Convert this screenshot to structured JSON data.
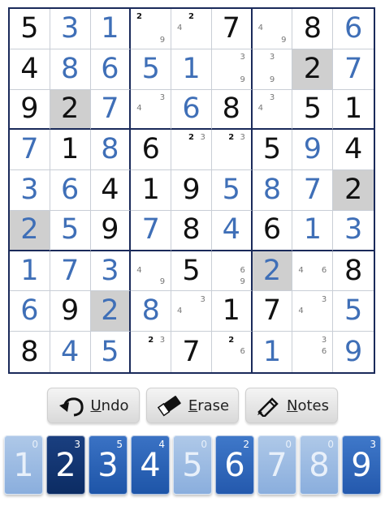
{
  "grid": [
    [
      {
        "v": "5",
        "t": "given"
      },
      {
        "v": "3",
        "t": "user"
      },
      {
        "v": "1",
        "t": "user"
      },
      {
        "v": "",
        "notes": [
          "2",
          "",
          "",
          "",
          "",
          "",
          "",
          "",
          "9"
        ],
        "bold": [
          "2"
        ]
      },
      {
        "v": "",
        "notes": [
          "",
          "2",
          "",
          "4",
          "",
          "",
          "",
          "",
          ""
        ],
        "bold": [
          "2"
        ]
      },
      {
        "v": "7",
        "t": "given"
      },
      {
        "v": "",
        "notes": [
          "",
          "",
          "",
          "4",
          "",
          "",
          "",
          "",
          "9"
        ]
      },
      {
        "v": "8",
        "t": "given"
      },
      {
        "v": "6",
        "t": "user"
      }
    ],
    [
      {
        "v": "4",
        "t": "given"
      },
      {
        "v": "8",
        "t": "user"
      },
      {
        "v": "6",
        "t": "user"
      },
      {
        "v": "5",
        "t": "user"
      },
      {
        "v": "1",
        "t": "user"
      },
      {
        "v": "",
        "notes": [
          "",
          "",
          "3",
          "",
          "",
          "",
          "",
          "",
          "9"
        ]
      },
      {
        "v": "",
        "notes": [
          "",
          "3",
          "",
          "",
          "",
          "",
          "",
          "9",
          ""
        ]
      },
      {
        "v": "2",
        "t": "given",
        "hl": true
      },
      {
        "v": "7",
        "t": "user"
      }
    ],
    [
      {
        "v": "9",
        "t": "given"
      },
      {
        "v": "2",
        "t": "given",
        "hl": true
      },
      {
        "v": "7",
        "t": "user"
      },
      {
        "v": "",
        "notes": [
          "",
          "",
          "3",
          "4",
          "",
          "",
          "",
          "",
          ""
        ]
      },
      {
        "v": "6",
        "t": "user"
      },
      {
        "v": "8",
        "t": "given"
      },
      {
        "v": "",
        "notes": [
          "",
          "3",
          "",
          "4",
          "",
          "",
          "",
          "",
          ""
        ]
      },
      {
        "v": "5",
        "t": "given"
      },
      {
        "v": "1",
        "t": "given"
      }
    ],
    [
      {
        "v": "7",
        "t": "user"
      },
      {
        "v": "1",
        "t": "given"
      },
      {
        "v": "8",
        "t": "user"
      },
      {
        "v": "6",
        "t": "given"
      },
      {
        "v": "",
        "notes": [
          "",
          "2",
          "3",
          "",
          "",
          "",
          "",
          "",
          ""
        ],
        "bold": [
          "2"
        ]
      },
      {
        "v": "",
        "notes": [
          "",
          "2",
          "3",
          "",
          "",
          "",
          "",
          "",
          ""
        ],
        "bold": [
          "2"
        ]
      },
      {
        "v": "5",
        "t": "given"
      },
      {
        "v": "9",
        "t": "user"
      },
      {
        "v": "4",
        "t": "given"
      }
    ],
    [
      {
        "v": "3",
        "t": "user"
      },
      {
        "v": "6",
        "t": "user"
      },
      {
        "v": "4",
        "t": "given"
      },
      {
        "v": "1",
        "t": "given"
      },
      {
        "v": "9",
        "t": "given"
      },
      {
        "v": "5",
        "t": "user"
      },
      {
        "v": "8",
        "t": "user"
      },
      {
        "v": "7",
        "t": "user"
      },
      {
        "v": "2",
        "t": "given",
        "hl": true
      }
    ],
    [
      {
        "v": "2",
        "t": "user",
        "hl": true
      },
      {
        "v": "5",
        "t": "user"
      },
      {
        "v": "9",
        "t": "given"
      },
      {
        "v": "7",
        "t": "user"
      },
      {
        "v": "8",
        "t": "given"
      },
      {
        "v": "4",
        "t": "user"
      },
      {
        "v": "6",
        "t": "given"
      },
      {
        "v": "1",
        "t": "user"
      },
      {
        "v": "3",
        "t": "user"
      }
    ],
    [
      {
        "v": "1",
        "t": "user"
      },
      {
        "v": "7",
        "t": "user"
      },
      {
        "v": "3",
        "t": "user"
      },
      {
        "v": "",
        "notes": [
          "",
          "",
          "",
          "4",
          "",
          "",
          "",
          "",
          "9"
        ]
      },
      {
        "v": "5",
        "t": "given"
      },
      {
        "v": "",
        "notes": [
          "",
          "",
          "",
          "",
          "",
          "6",
          "",
          "",
          "9"
        ]
      },
      {
        "v": "2",
        "t": "user",
        "hl": true
      },
      {
        "v": "",
        "notes": [
          "",
          "",
          "",
          "4",
          "",
          "6",
          "",
          "",
          ""
        ]
      },
      {
        "v": "8",
        "t": "given"
      }
    ],
    [
      {
        "v": "6",
        "t": "user"
      },
      {
        "v": "9",
        "t": "given"
      },
      {
        "v": "2",
        "t": "user",
        "hl": true
      },
      {
        "v": "8",
        "t": "user"
      },
      {
        "v": "",
        "notes": [
          "",
          "",
          "3",
          "4",
          "",
          "",
          "",
          "",
          ""
        ]
      },
      {
        "v": "1",
        "t": "given"
      },
      {
        "v": "7",
        "t": "given"
      },
      {
        "v": "",
        "notes": [
          "",
          "",
          "3",
          "4",
          "",
          "",
          "",
          "",
          ""
        ]
      },
      {
        "v": "5",
        "t": "user"
      }
    ],
    [
      {
        "v": "8",
        "t": "given"
      },
      {
        "v": "4",
        "t": "user"
      },
      {
        "v": "5",
        "t": "user"
      },
      {
        "v": "",
        "notes": [
          "",
          "2",
          "3",
          "",
          "",
          "",
          "",
          "",
          ""
        ],
        "bold": [
          "2"
        ]
      },
      {
        "v": "7",
        "t": "given"
      },
      {
        "v": "",
        "notes": [
          "",
          "2",
          "",
          "",
          "",
          "6",
          "",
          "",
          ""
        ],
        "bold": [
          "2"
        ]
      },
      {
        "v": "1",
        "t": "user"
      },
      {
        "v": "",
        "notes": [
          "",
          "",
          "3",
          "",
          "",
          "6",
          "",
          "",
          ""
        ]
      },
      {
        "v": "9",
        "t": "user"
      }
    ]
  ],
  "toolbar": {
    "undo_label": "Undo",
    "erase_label": "Erase",
    "notes_label": "Notes"
  },
  "numpad": [
    {
      "digit": "1",
      "count": "0",
      "style": "k-done"
    },
    {
      "digit": "2",
      "count": "3",
      "style": "k-sel"
    },
    {
      "digit": "3",
      "count": "5",
      "style": "k-mid"
    },
    {
      "digit": "4",
      "count": "4",
      "style": "k-mid"
    },
    {
      "digit": "5",
      "count": "0",
      "style": "k-done"
    },
    {
      "digit": "6",
      "count": "2",
      "style": "k-mid2"
    },
    {
      "digit": "7",
      "count": "0",
      "style": "k-done"
    },
    {
      "digit": "8",
      "count": "0",
      "style": "k-done"
    },
    {
      "digit": "9",
      "count": "3",
      "style": "k-mid2"
    }
  ],
  "icons": {
    "undo": "undo-arrow-icon",
    "erase": "eraser-icon",
    "notes": "pencil-icon"
  },
  "colors": {
    "given": "#111111",
    "user": "#3f6fb7",
    "highlight": "#cfcfcf",
    "border": "#1a2a5a"
  }
}
